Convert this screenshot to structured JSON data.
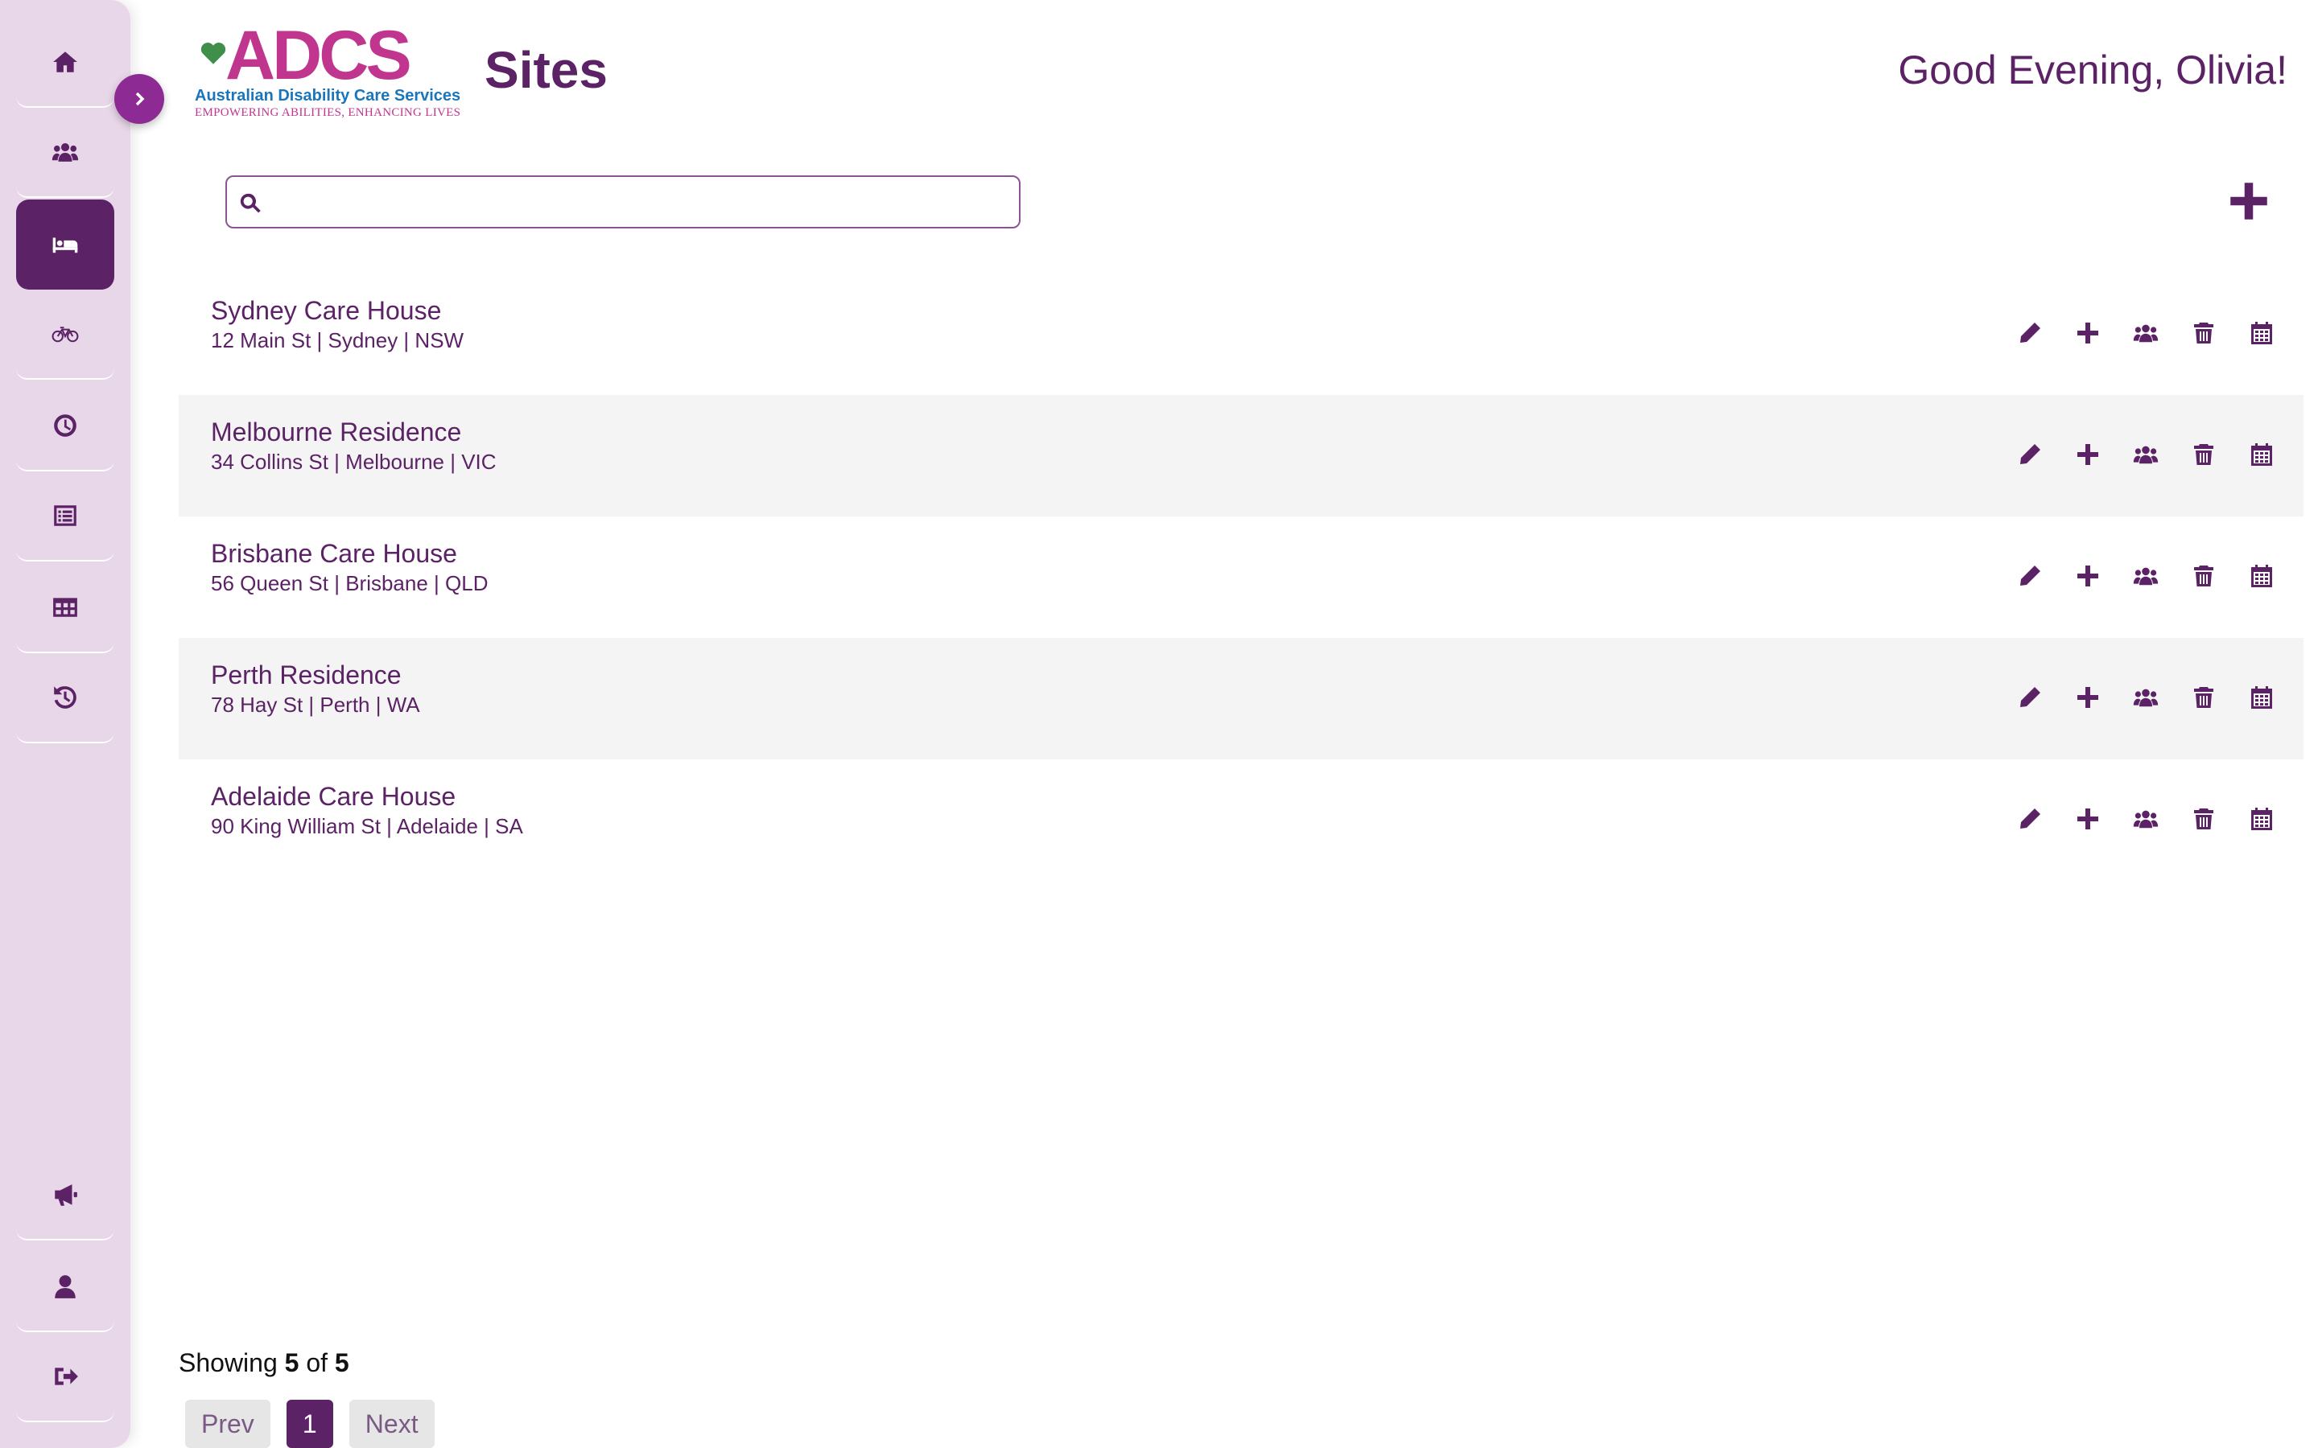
{
  "header": {
    "title": "Sites",
    "greeting": "Good Evening, Olivia!"
  },
  "logo": {
    "wordmark": "ADCS",
    "name": "Australian Disability Care Services",
    "tagline": "EMPOWERING ABILITIES, ENHANCING LIVES"
  },
  "colors": {
    "primary": "#5c2266",
    "sidebar_bg": "#e8d7e8",
    "toggle": "#8e2a93",
    "logo_magenta": "#c0368f",
    "logo_blue": "#1b75bb"
  },
  "sidebar": {
    "top_items": [
      {
        "icon": "home-icon",
        "active": false
      },
      {
        "icon": "users-icon",
        "active": false
      },
      {
        "icon": "bed-icon",
        "active": true
      },
      {
        "icon": "bicycle-icon",
        "active": false
      },
      {
        "icon": "clock-icon",
        "active": false
      },
      {
        "icon": "list-alt-icon",
        "active": false
      },
      {
        "icon": "table-icon",
        "active": false
      },
      {
        "icon": "history-icon",
        "active": false
      }
    ],
    "bottom_items": [
      {
        "icon": "megaphone-icon"
      },
      {
        "icon": "user-icon"
      },
      {
        "icon": "sign-out-icon"
      }
    ]
  },
  "search": {
    "value": "",
    "placeholder": ""
  },
  "sites": [
    {
      "name": "Sydney Care House",
      "address": "12 Main St | Sydney | NSW"
    },
    {
      "name": "Melbourne Residence",
      "address": "34 Collins St | Melbourne | VIC"
    },
    {
      "name": "Brisbane Care House",
      "address": "56 Queen St | Brisbane | QLD"
    },
    {
      "name": "Perth Residence",
      "address": "78 Hay St | Perth | WA"
    },
    {
      "name": "Adelaide Care House",
      "address": "90 King William St | Adelaide | SA"
    }
  ],
  "row_actions": [
    "pencil-icon",
    "plus-icon",
    "users-icon",
    "trash-icon",
    "calendar-icon"
  ],
  "pagination": {
    "showing_label": "Showing",
    "showing_count": "5",
    "of_label": "of",
    "total": "5",
    "prev_label": "Prev",
    "current_page": "1",
    "next_label": "Next"
  }
}
